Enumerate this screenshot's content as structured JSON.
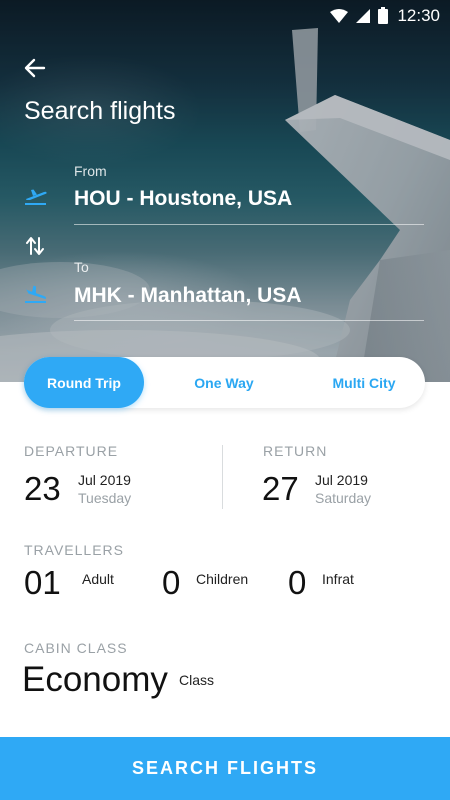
{
  "status": {
    "time": "12:30"
  },
  "header": {
    "title": "Search flights"
  },
  "route": {
    "from_label": "From",
    "from_value": "HOU - Houstone, USA",
    "to_label": "To",
    "to_value": "MHK - Manhattan, USA"
  },
  "trip_types": [
    {
      "label": "Round Trip",
      "active": true
    },
    {
      "label": "One Way",
      "active": false
    },
    {
      "label": "Multi City",
      "active": false
    }
  ],
  "departure": {
    "label": "DEPARTURE",
    "day": "23",
    "month_year": "Jul 2019",
    "weekday": "Tuesday"
  },
  "return": {
    "label": "RETURN",
    "day": "27",
    "month_year": "Jul 2019",
    "weekday": "Saturday"
  },
  "travellers": {
    "label": "TRAVELLERS",
    "adult_count": "01",
    "adult_label": "Adult",
    "children_count": "0",
    "children_label": "Children",
    "infant_count": "0",
    "infant_label": "Infrat"
  },
  "cabin": {
    "label": "CABIN CLASS",
    "value": "Economy",
    "suffix": "Class"
  },
  "search_button": {
    "label": "SEARCH FLIGHTS"
  },
  "colors": {
    "accent": "#2fa9f5",
    "accent_text": "#2aa7f2",
    "label_gray": "#9aa1a6"
  },
  "icons": [
    "wifi-icon",
    "signal-icon",
    "battery-icon",
    "back-arrow-icon",
    "takeoff-icon",
    "swap-icon",
    "landing-icon"
  ]
}
